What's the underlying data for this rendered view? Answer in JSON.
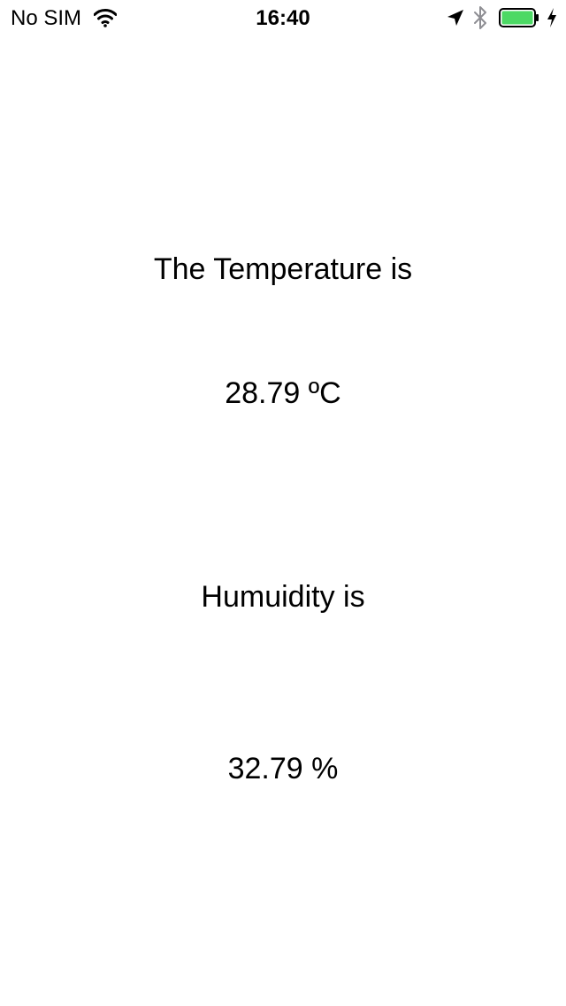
{
  "status_bar": {
    "carrier": "No SIM",
    "time": "16:40",
    "icons": [
      "wifi-icon",
      "location-arrow-icon",
      "bluetooth-icon",
      "battery-icon",
      "charging-bolt-icon"
    ],
    "battery_color": "#4cd964"
  },
  "main": {
    "temperature_heading": "The Temperature is",
    "temperature_value": "28.79 ºC",
    "humidity_heading": "Humuidity is",
    "humidity_value": "32.79 %"
  }
}
